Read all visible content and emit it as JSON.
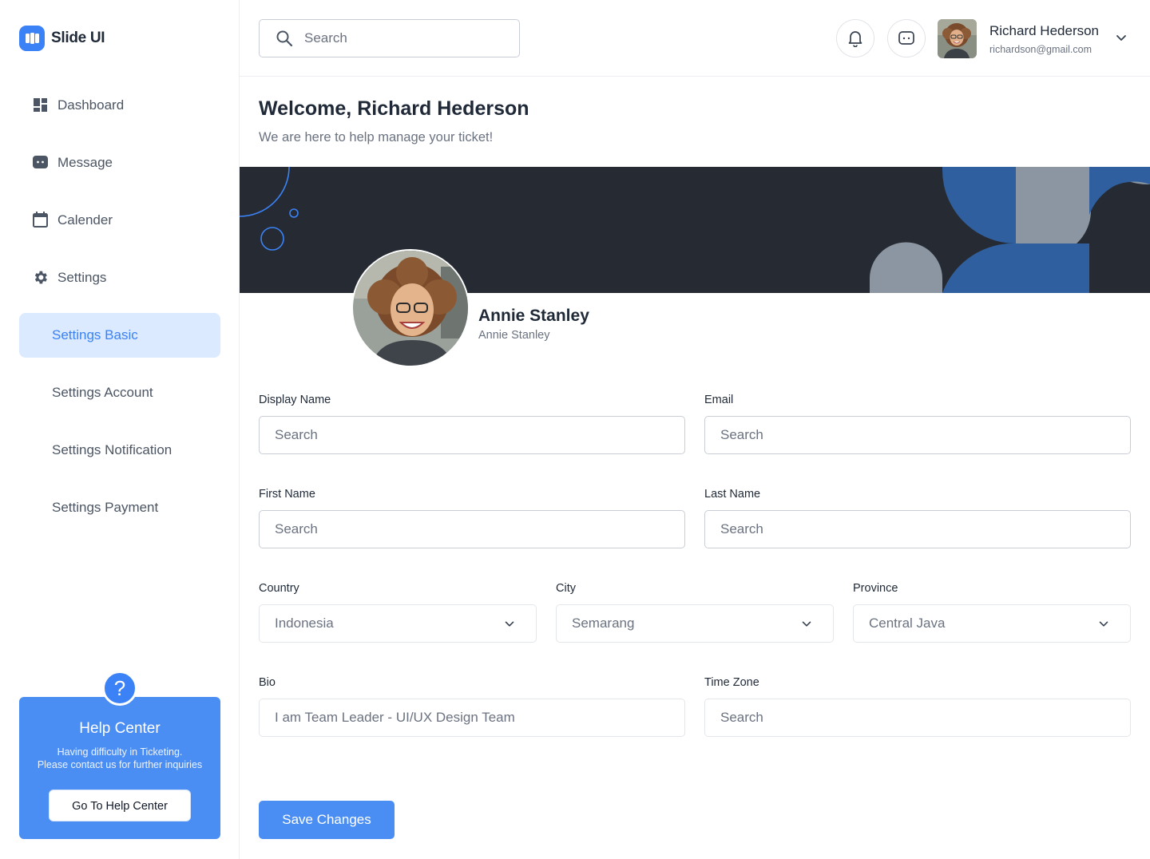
{
  "app": {
    "name": "Slide UI"
  },
  "sidebar": {
    "nav": [
      {
        "label": "Dashboard",
        "icon": "dashboard-icon"
      },
      {
        "label": "Message",
        "icon": "message-icon"
      },
      {
        "label": "Calender",
        "icon": "calendar-icon"
      },
      {
        "label": "Settings",
        "icon": "gear-icon"
      }
    ],
    "settings_sub": [
      {
        "label": "Settings Basic",
        "active": true
      },
      {
        "label": "Settings Account"
      },
      {
        "label": "Settings Notification"
      },
      {
        "label": "Settings Payment"
      }
    ],
    "help": {
      "icon": "question-icon",
      "title": "Help Center",
      "line1": "Having difficulty in Ticketing.",
      "line2": "Please contact us for further inquiries",
      "button": "Go To Help Center"
    }
  },
  "topbar": {
    "search_placeholder": "Search",
    "user": {
      "name": "Richard Hederson",
      "email": "richardson@gmail.com"
    }
  },
  "main": {
    "title": "Welcome, Richard Hederson",
    "subtitle": "We are here to help manage your ticket!",
    "profile": {
      "name": "Annie Stanley",
      "sub": "Annie Stanley"
    },
    "form": {
      "display_name": {
        "label": "Display Name",
        "placeholder": "Search"
      },
      "email": {
        "label": "Email",
        "placeholder": "Search"
      },
      "first_name": {
        "label": "First Name",
        "placeholder": "Search"
      },
      "last_name": {
        "label": "Last Name",
        "placeholder": "Search"
      },
      "country": {
        "label": "Country",
        "value": "Indonesia"
      },
      "city": {
        "label": "City",
        "value": "Semarang"
      },
      "province": {
        "label": "Province",
        "value": "Central Java"
      },
      "bio": {
        "label": "Bio",
        "value": "I am Team Leader - UI/UX Design Team"
      },
      "time_zone": {
        "label": "Time Zone",
        "placeholder": "Search"
      }
    },
    "save_button": "Save Changes"
  },
  "colors": {
    "accent": "#3b82f6",
    "accent_light": "#dbeafe",
    "banner_dark": "#262b33",
    "banner_blue": "#2f5f9e",
    "banner_gray": "#8c96a3"
  }
}
